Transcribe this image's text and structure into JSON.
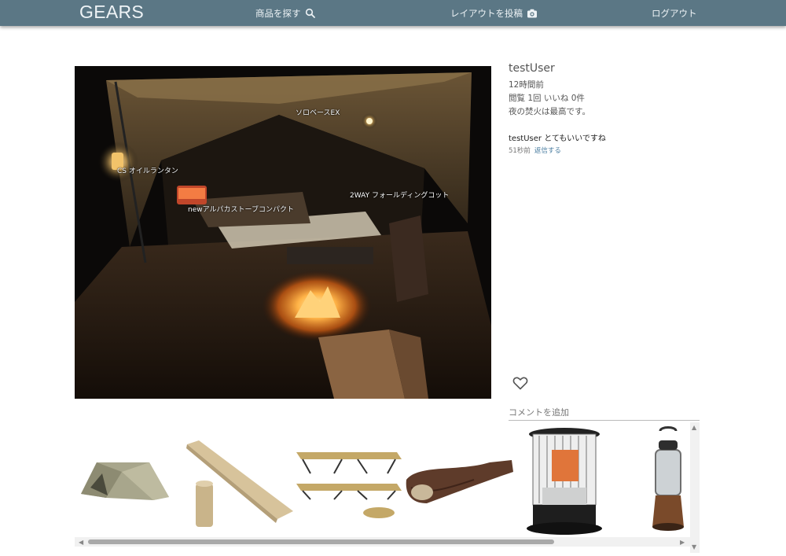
{
  "nav": {
    "brand": "GEARS",
    "search_label": "商品を探す",
    "post_label": "レイアウトを投稿",
    "logout_label": "ログアウト"
  },
  "post": {
    "author": "testUser",
    "time_ago": "12時間前",
    "stats": "閲覧 1回 いいね 0件",
    "caption": "夜の焚火は最高です。",
    "photo_tags": [
      {
        "label": "ソロベースEX"
      },
      {
        "label": "CS オイルランタン"
      },
      {
        "label": "2WAY フォールディングコット"
      },
      {
        "label": "newアルパカストーブコンパクト"
      }
    ]
  },
  "comments": [
    {
      "user": "testUser",
      "text": "とてもいいですね",
      "time_ago": "51秒前",
      "reply_label": "返信する"
    }
  ],
  "comment_form": {
    "placeholder": "コメントを追加"
  },
  "products": [
    {
      "name": "tent",
      "icon": "tent-image"
    },
    {
      "name": "sleeping-mat",
      "icon": "mat-image"
    },
    {
      "name": "folding-cot",
      "icon": "cot-image"
    },
    {
      "name": "sleeping-bag",
      "icon": "sleeping-bag-image"
    },
    {
      "name": "kerosene-stove",
      "icon": "stove-image"
    },
    {
      "name": "oil-lantern",
      "icon": "lantern-image"
    }
  ],
  "colors": {
    "nav_bg": "#5b7785",
    "nav_text": "#eef3f6",
    "link": "#4a7da0"
  }
}
